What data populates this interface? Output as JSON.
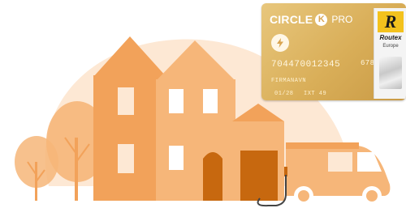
{
  "card": {
    "brand": "CIRCLE",
    "brand_k": "K",
    "tier": "PRO",
    "number": "704470012345",
    "number_tail": "678901",
    "holder": "FIRMANAVN",
    "expiry": "01/28",
    "code": "IXT 49"
  },
  "partner": {
    "letter": "R",
    "name": "Routex",
    "region": "Europe"
  },
  "icons": {
    "charging": "lightning-bolt-icon"
  },
  "colors": {
    "orange_light": "#fde8d4",
    "orange_mid": "#f6b679",
    "orange_main": "#f2a25a",
    "orange_dark": "#c7680f",
    "card_gold": "#d9ae58",
    "partner_yellow": "#f3c21d"
  }
}
